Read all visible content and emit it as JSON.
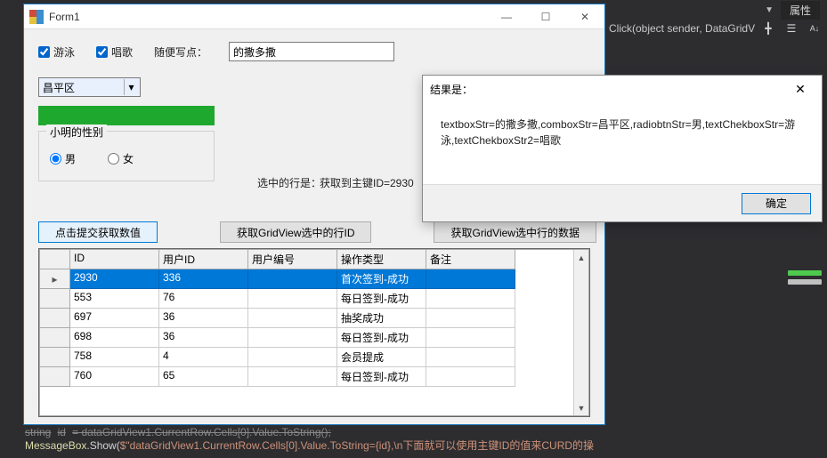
{
  "vs": {
    "properties_label": "属性",
    "method_signature": "Click(object sender, DataGridV",
    "codeline0": "string id = dataGridView1.CurrentRow.Cells[0].Value.ToString();",
    "codeline_method": "MessageBox",
    "codeline_call": ".Show(",
    "codeline_str": "$\"dataGridView1.CurrentRow.Cells[0].Value.ToString={id},\\n下面就可以使用主键ID的值来CURD的操"
  },
  "window": {
    "title": "Form1",
    "checkboxes": {
      "swim": "游泳",
      "sing": "唱歌"
    },
    "freewrite_label": "随便写点：",
    "freewrite_value": "的撒多撒",
    "combo_value": "昌平区",
    "fieldset_legend": "小明的性别",
    "radio_male": "男",
    "radio_female": "女",
    "selrow_label": "选中的行是：",
    "selrow_value": "获取到主键ID=2930",
    "buttons": {
      "submit": "点击提交获取数值",
      "get_rowid": "获取GridView选中的行ID",
      "get_rowdata": "获取GridView选中行的数据"
    },
    "grid": {
      "columns": [
        "ID",
        "用户ID",
        "用户编号",
        "操作类型",
        "备注"
      ],
      "rows": [
        {
          "id": "2930",
          "uid": "336",
          "uno": "",
          "op": "首次签到-成功",
          "bz": ""
        },
        {
          "id": "553",
          "uid": "76",
          "uno": "",
          "op": "每日签到-成功",
          "bz": ""
        },
        {
          "id": "697",
          "uid": "36",
          "uno": "",
          "op": "抽奖成功",
          "bz": ""
        },
        {
          "id": "698",
          "uid": "36",
          "uno": "",
          "op": "每日签到-成功",
          "bz": ""
        },
        {
          "id": "758",
          "uid": "4",
          "uno": "",
          "op": "会员提成",
          "bz": ""
        },
        {
          "id": "760",
          "uid": "65",
          "uno": "",
          "op": "每日签到-成功",
          "bz": ""
        }
      ],
      "selected_index": 0
    }
  },
  "msgbox": {
    "title": "结果是：",
    "body": "textboxStr=的撒多撒,comboxStr=昌平区,radiobtnStr=男,textChekboxStr=游泳,textChekboxStr2=唱歌",
    "ok": "确定"
  }
}
